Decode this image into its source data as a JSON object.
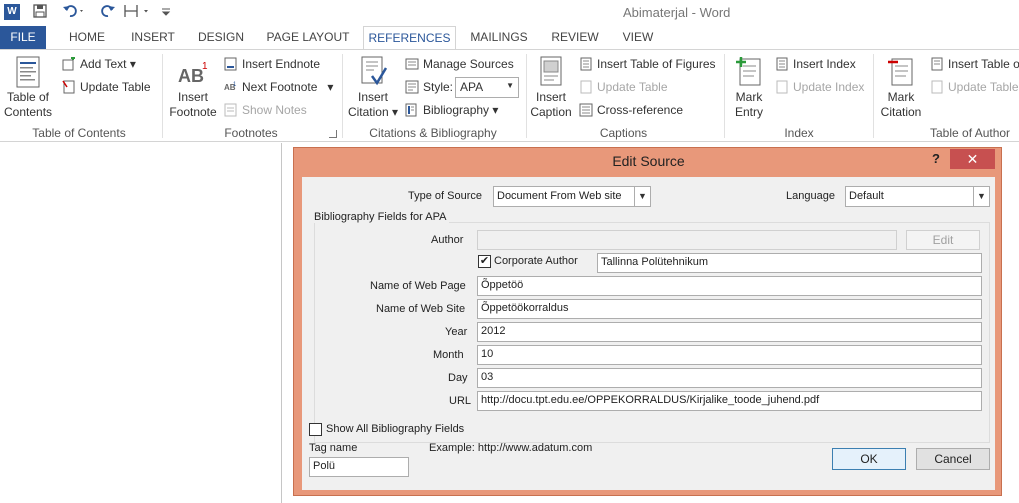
{
  "window": {
    "title": "Abimaterjal - Word"
  },
  "tabs": [
    "FILE",
    "HOME",
    "INSERT",
    "DESIGN",
    "PAGE LAYOUT",
    "REFERENCES",
    "MAILINGS",
    "REVIEW",
    "VIEW"
  ],
  "ribbon": {
    "toc": {
      "table_of_contents_1": "Table of",
      "table_of_contents_2": "Contents",
      "add_text": "Add Text",
      "update_table": "Update Table",
      "label": "Table of Contents"
    },
    "footnotes": {
      "insert_footnote_1": "Insert",
      "insert_footnote_2": "Footnote",
      "insert_endnote": "Insert Endnote",
      "next_footnote": "Next Footnote",
      "show_notes": "Show Notes",
      "label": "Footnotes"
    },
    "citations": {
      "insert_citation_1": "Insert",
      "insert_citation_2": "Citation",
      "manage_sources": "Manage Sources",
      "style_label": "Style:",
      "style_value": "APA",
      "bibliography": "Bibliography",
      "label": "Citations & Bibliography"
    },
    "captions": {
      "insert_caption_1": "Insert",
      "insert_caption_2": "Caption",
      "insert_table_of_figures": "Insert Table of Figures",
      "update_table": "Update Table",
      "cross_reference": "Cross-reference",
      "label": "Captions"
    },
    "index": {
      "mark_entry_1": "Mark",
      "mark_entry_2": "Entry",
      "insert_index": "Insert Index",
      "update_index": "Update Index",
      "label": "Index"
    },
    "authorities": {
      "mark_citation_1": "Mark",
      "mark_citation_2": "Citation",
      "insert_table": "Insert Table o",
      "update_table": "Update Table",
      "label": "Table of Author"
    }
  },
  "dialog": {
    "title": "Edit Source",
    "help": "?",
    "close": "✕",
    "type_of_source_label": "Type of Source",
    "type_of_source_value": "Document From Web site",
    "language_label": "Language",
    "language_value": "Default",
    "bib_fields_label": "Bibliography Fields for APA",
    "author_label": "Author",
    "author_value": "",
    "edit_button": "Edit",
    "corporate_author_label": "Corporate Author",
    "corporate_author_checked": true,
    "corporate_author_value": "Tallinna Polütehnikum",
    "fields": [
      {
        "label": "Name of Web Page",
        "value": "Õppetöö"
      },
      {
        "label": "Name of Web Site",
        "value": "Õppetöökorraldus"
      },
      {
        "label": "Year",
        "value": "2012"
      },
      {
        "label": "Month",
        "value": "10"
      },
      {
        "label": "Day",
        "value": "03"
      },
      {
        "label": "URL",
        "value": "http://docu.tpt.edu.ee/OPPEKORRALDUS/Kirjalike_toode_juhend.pdf"
      }
    ],
    "show_all_label": "Show All Bibliography Fields",
    "tag_name_label": "Tag name",
    "tag_name_value": "Polü",
    "example_text": "Example: http://www.adatum.com",
    "ok_button": "OK",
    "cancel_button": "Cancel"
  }
}
